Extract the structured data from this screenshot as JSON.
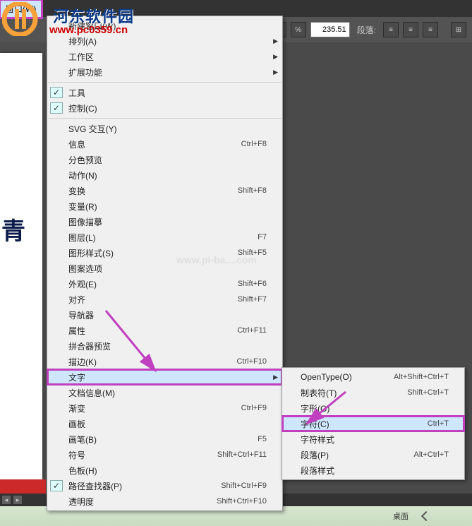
{
  "menubar": {
    "window": "窗口(W)"
  },
  "toolbar": {
    "value": "235.51",
    "paragraph_label": "段落:"
  },
  "watermark": {
    "title": "河东软件园",
    "url": "www.pc0359.cn",
    "center": "www.pi-ba....com"
  },
  "artboard": {
    "glyph": "青"
  },
  "menu": {
    "items": [
      {
        "label": "新建窗口(W)",
        "shortcut": "",
        "submenu": false,
        "checked": false
      },
      {
        "label": "排列(A)",
        "shortcut": "",
        "submenu": true,
        "checked": false
      },
      {
        "label": "工作区",
        "shortcut": "",
        "submenu": true,
        "checked": false
      },
      {
        "label": "扩展功能",
        "shortcut": "",
        "submenu": true,
        "checked": false
      },
      {
        "sep": true
      },
      {
        "label": "工具",
        "shortcut": "",
        "submenu": false,
        "checked": true
      },
      {
        "label": "控制(C)",
        "shortcut": "",
        "submenu": false,
        "checked": true
      },
      {
        "sep": true
      },
      {
        "label": "SVG 交互(Y)",
        "shortcut": "",
        "submenu": false,
        "checked": false
      },
      {
        "label": "信息",
        "shortcut": "Ctrl+F8",
        "submenu": false,
        "checked": false
      },
      {
        "label": "分色预览",
        "shortcut": "",
        "submenu": false,
        "checked": false
      },
      {
        "label": "动作(N)",
        "shortcut": "",
        "submenu": false,
        "checked": false
      },
      {
        "label": "变换",
        "shortcut": "Shift+F8",
        "submenu": false,
        "checked": false
      },
      {
        "label": "变量(R)",
        "shortcut": "",
        "submenu": false,
        "checked": false
      },
      {
        "label": "图像描摹",
        "shortcut": "",
        "submenu": false,
        "checked": false
      },
      {
        "label": "图层(L)",
        "shortcut": "F7",
        "submenu": false,
        "checked": false
      },
      {
        "label": "图形样式(S)",
        "shortcut": "Shift+F5",
        "submenu": false,
        "checked": false
      },
      {
        "label": "图案选项",
        "shortcut": "",
        "submenu": false,
        "checked": false
      },
      {
        "label": "外观(E)",
        "shortcut": "Shift+F6",
        "submenu": false,
        "checked": false
      },
      {
        "label": "对齐",
        "shortcut": "Shift+F7",
        "submenu": false,
        "checked": false
      },
      {
        "label": "导航器",
        "shortcut": "",
        "submenu": false,
        "checked": false
      },
      {
        "label": "属性",
        "shortcut": "Ctrl+F11",
        "submenu": false,
        "checked": false
      },
      {
        "label": "拼合器预览",
        "shortcut": "",
        "submenu": false,
        "checked": false
      },
      {
        "label": "描边(K)",
        "shortcut": "Ctrl+F10",
        "submenu": false,
        "checked": false
      },
      {
        "label": "文字",
        "shortcut": "",
        "submenu": true,
        "checked": false,
        "hover": true
      },
      {
        "label": "文档信息(M)",
        "shortcut": "",
        "submenu": false,
        "checked": false
      },
      {
        "label": "渐变",
        "shortcut": "Ctrl+F9",
        "submenu": false,
        "checked": false
      },
      {
        "label": "画板",
        "shortcut": "",
        "submenu": false,
        "checked": false
      },
      {
        "label": "画笔(B)",
        "shortcut": "F5",
        "submenu": false,
        "checked": false
      },
      {
        "label": "符号",
        "shortcut": "Shift+Ctrl+F11",
        "submenu": false,
        "checked": false
      },
      {
        "label": "色板(H)",
        "shortcut": "",
        "submenu": false,
        "checked": false
      },
      {
        "label": "路径查找器(P)",
        "shortcut": "Shift+Ctrl+F9",
        "submenu": false,
        "checked": true
      },
      {
        "label": "透明度",
        "shortcut": "Shift+Ctrl+F10",
        "submenu": false,
        "checked": false
      }
    ]
  },
  "submenu": {
    "items": [
      {
        "label": "OpenType(O)",
        "shortcut": "Alt+Shift+Ctrl+T"
      },
      {
        "label": "制表符(T)",
        "shortcut": "Shift+Ctrl+T"
      },
      {
        "label": "字形(G)",
        "shortcut": ""
      },
      {
        "label": "字符(C)",
        "shortcut": "Ctrl+T",
        "hover": true
      },
      {
        "label": "字符样式",
        "shortcut": ""
      },
      {
        "label": "段落(P)",
        "shortcut": "Alt+Ctrl+T"
      },
      {
        "label": "段落样式",
        "shortcut": ""
      }
    ]
  },
  "taskbar": {
    "desktop": "桌面"
  }
}
